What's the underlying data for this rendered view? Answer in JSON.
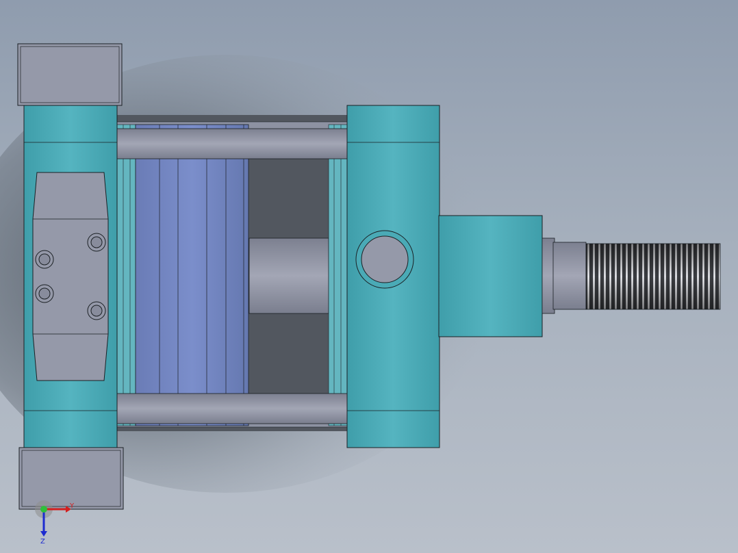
{
  "viewport": {
    "background_top": "#8f9cae",
    "background_bottom": "#b9c0ca"
  },
  "model": {
    "body_color": "#47a8b5",
    "body_highlight": "#5bb8c4",
    "steel_color": "#9396a6",
    "piston_color": "#6f82be",
    "dark_gap_color": "#52575f",
    "outline_color": "#1a1f23"
  },
  "triad": {
    "x_label": "Y",
    "y_label": "Z",
    "x_color": "#d32020",
    "y_color": "#1d2bd0",
    "origin_color": "#2fbf3a"
  }
}
